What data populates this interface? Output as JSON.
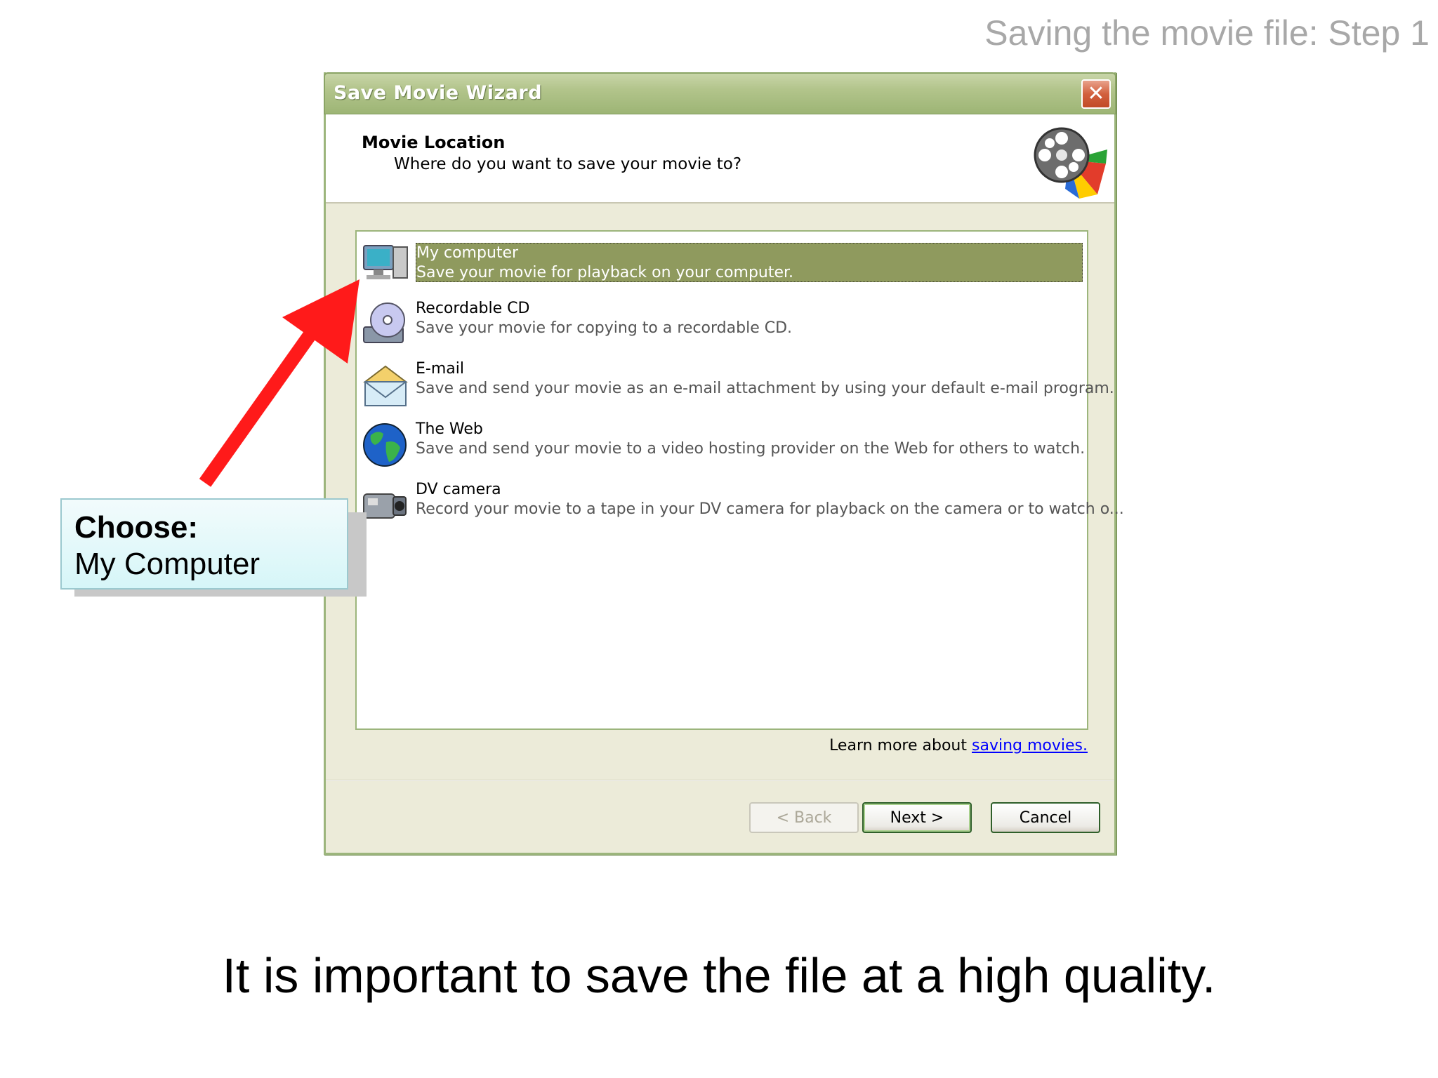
{
  "slide": {
    "title": "Saving the movie file: Step 1",
    "caption": "It is important to save the file at a high quality."
  },
  "window": {
    "title": "Save Movie Wizard",
    "close_symbol": "✕",
    "header_title": "Movie Location",
    "header_subtitle": "Where do you want to save your movie to?",
    "header_icon": "film-reel-icon"
  },
  "options": [
    {
      "title": "My computer",
      "description": "Save your movie for playback on your computer.",
      "icon": "computer-icon",
      "selected": true
    },
    {
      "title": "Recordable CD",
      "description": "Save your movie for copying to a recordable CD.",
      "icon": "cd-icon",
      "selected": false
    },
    {
      "title": "E-mail",
      "description": "Save and send your movie as an e-mail attachment by using your default e-mail program.",
      "icon": "email-icon",
      "selected": false
    },
    {
      "title": "The Web",
      "description": "Save and send your movie to a video hosting provider on the Web for others to watch.",
      "icon": "globe-icon",
      "selected": false
    },
    {
      "title": "DV camera",
      "description": "Record your movie to a tape in your DV camera for playback on the camera or to watch o...",
      "icon": "camcorder-icon",
      "selected": false
    }
  ],
  "learn_more": {
    "prefix": "Learn more about ",
    "link": "saving movies."
  },
  "buttons": {
    "back": "< Back",
    "next": "Next >",
    "cancel": "Cancel"
  },
  "callout": {
    "heading": "Choose:",
    "body": "My Computer"
  },
  "colors": {
    "selection": "#8f9a5e",
    "arrow": "#ff0000",
    "callout_bg": "#d6f6f8"
  }
}
